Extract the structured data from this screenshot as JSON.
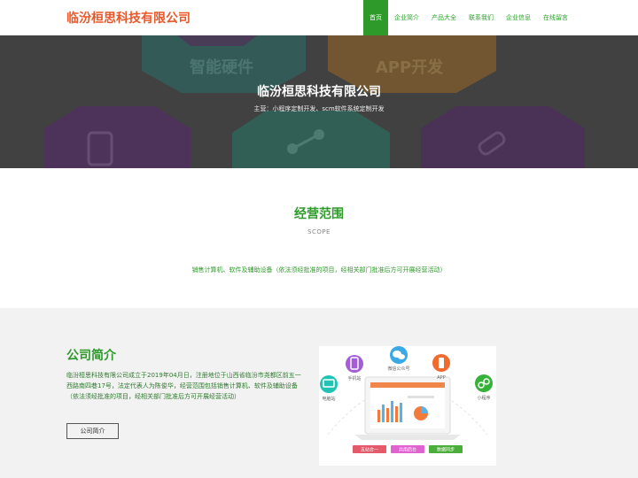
{
  "header": {
    "logo": "临汾桓思科技有限公司",
    "nav": [
      "首页",
      "企业简介",
      "产品大全",
      "联系我们",
      "企业信息",
      "在线留言"
    ],
    "active_index": 0
  },
  "hero": {
    "title": "临汾桓思科技有限公司",
    "subtitle": "主营：小程序定制开发、scm软件系统定制开发",
    "bg_text_left": "智能硬件",
    "bg_text_right": "APP开发"
  },
  "scope": {
    "title": "经营范围",
    "subtitle": "SCOPE",
    "text": "销售计算机、软件及辅助设备（依法须经批准的项目，经相关部门批准后方可开展经营活动）"
  },
  "about": {
    "title": "公司简介",
    "text": "临汾桓思科技有限公司成立于2019年04月日，注册地位于山西省临汾市尧都区前五一西路南四巷17号，法定代表人为陈俊华，经营范围包括销售计算机、软件及辅助设备（依法须经批准的项目，经相关部门批准后方可开展经营活动）",
    "button": "公司简介",
    "illustration": {
      "labels": [
        "手机站",
        "微信公众号",
        "APP",
        "电脑站",
        "小程序"
      ],
      "bars": [
        "五站合一",
        "共用后台",
        "数据同步"
      ]
    }
  },
  "colors": {
    "green": "#2e9a2a",
    "logo": "#e8582a",
    "grey_bg": "#f2f2f2"
  }
}
